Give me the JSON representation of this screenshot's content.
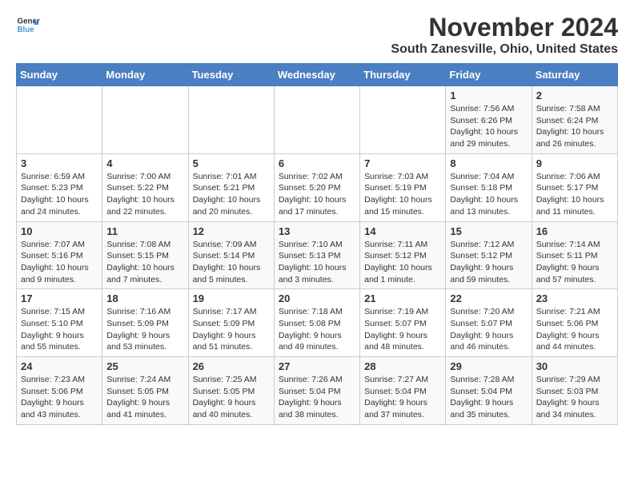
{
  "header": {
    "logo_general": "General",
    "logo_blue": "Blue",
    "month": "November 2024",
    "location": "South Zanesville, Ohio, United States"
  },
  "days_of_week": [
    "Sunday",
    "Monday",
    "Tuesday",
    "Wednesday",
    "Thursday",
    "Friday",
    "Saturday"
  ],
  "weeks": [
    [
      {
        "day": "",
        "detail": ""
      },
      {
        "day": "",
        "detail": ""
      },
      {
        "day": "",
        "detail": ""
      },
      {
        "day": "",
        "detail": ""
      },
      {
        "day": "",
        "detail": ""
      },
      {
        "day": "1",
        "detail": "Sunrise: 7:56 AM\nSunset: 6:26 PM\nDaylight: 10 hours and 29 minutes."
      },
      {
        "day": "2",
        "detail": "Sunrise: 7:58 AM\nSunset: 6:24 PM\nDaylight: 10 hours and 26 minutes."
      }
    ],
    [
      {
        "day": "3",
        "detail": "Sunrise: 6:59 AM\nSunset: 5:23 PM\nDaylight: 10 hours and 24 minutes."
      },
      {
        "day": "4",
        "detail": "Sunrise: 7:00 AM\nSunset: 5:22 PM\nDaylight: 10 hours and 22 minutes."
      },
      {
        "day": "5",
        "detail": "Sunrise: 7:01 AM\nSunset: 5:21 PM\nDaylight: 10 hours and 20 minutes."
      },
      {
        "day": "6",
        "detail": "Sunrise: 7:02 AM\nSunset: 5:20 PM\nDaylight: 10 hours and 17 minutes."
      },
      {
        "day": "7",
        "detail": "Sunrise: 7:03 AM\nSunset: 5:19 PM\nDaylight: 10 hours and 15 minutes."
      },
      {
        "day": "8",
        "detail": "Sunrise: 7:04 AM\nSunset: 5:18 PM\nDaylight: 10 hours and 13 minutes."
      },
      {
        "day": "9",
        "detail": "Sunrise: 7:06 AM\nSunset: 5:17 PM\nDaylight: 10 hours and 11 minutes."
      }
    ],
    [
      {
        "day": "10",
        "detail": "Sunrise: 7:07 AM\nSunset: 5:16 PM\nDaylight: 10 hours and 9 minutes."
      },
      {
        "day": "11",
        "detail": "Sunrise: 7:08 AM\nSunset: 5:15 PM\nDaylight: 10 hours and 7 minutes."
      },
      {
        "day": "12",
        "detail": "Sunrise: 7:09 AM\nSunset: 5:14 PM\nDaylight: 10 hours and 5 minutes."
      },
      {
        "day": "13",
        "detail": "Sunrise: 7:10 AM\nSunset: 5:13 PM\nDaylight: 10 hours and 3 minutes."
      },
      {
        "day": "14",
        "detail": "Sunrise: 7:11 AM\nSunset: 5:12 PM\nDaylight: 10 hours and 1 minute."
      },
      {
        "day": "15",
        "detail": "Sunrise: 7:12 AM\nSunset: 5:12 PM\nDaylight: 9 hours and 59 minutes."
      },
      {
        "day": "16",
        "detail": "Sunrise: 7:14 AM\nSunset: 5:11 PM\nDaylight: 9 hours and 57 minutes."
      }
    ],
    [
      {
        "day": "17",
        "detail": "Sunrise: 7:15 AM\nSunset: 5:10 PM\nDaylight: 9 hours and 55 minutes."
      },
      {
        "day": "18",
        "detail": "Sunrise: 7:16 AM\nSunset: 5:09 PM\nDaylight: 9 hours and 53 minutes."
      },
      {
        "day": "19",
        "detail": "Sunrise: 7:17 AM\nSunset: 5:09 PM\nDaylight: 9 hours and 51 minutes."
      },
      {
        "day": "20",
        "detail": "Sunrise: 7:18 AM\nSunset: 5:08 PM\nDaylight: 9 hours and 49 minutes."
      },
      {
        "day": "21",
        "detail": "Sunrise: 7:19 AM\nSunset: 5:07 PM\nDaylight: 9 hours and 48 minutes."
      },
      {
        "day": "22",
        "detail": "Sunrise: 7:20 AM\nSunset: 5:07 PM\nDaylight: 9 hours and 46 minutes."
      },
      {
        "day": "23",
        "detail": "Sunrise: 7:21 AM\nSunset: 5:06 PM\nDaylight: 9 hours and 44 minutes."
      }
    ],
    [
      {
        "day": "24",
        "detail": "Sunrise: 7:23 AM\nSunset: 5:06 PM\nDaylight: 9 hours and 43 minutes."
      },
      {
        "day": "25",
        "detail": "Sunrise: 7:24 AM\nSunset: 5:05 PM\nDaylight: 9 hours and 41 minutes."
      },
      {
        "day": "26",
        "detail": "Sunrise: 7:25 AM\nSunset: 5:05 PM\nDaylight: 9 hours and 40 minutes."
      },
      {
        "day": "27",
        "detail": "Sunrise: 7:26 AM\nSunset: 5:04 PM\nDaylight: 9 hours and 38 minutes."
      },
      {
        "day": "28",
        "detail": "Sunrise: 7:27 AM\nSunset: 5:04 PM\nDaylight: 9 hours and 37 minutes."
      },
      {
        "day": "29",
        "detail": "Sunrise: 7:28 AM\nSunset: 5:04 PM\nDaylight: 9 hours and 35 minutes."
      },
      {
        "day": "30",
        "detail": "Sunrise: 7:29 AM\nSunset: 5:03 PM\nDaylight: 9 hours and 34 minutes."
      }
    ]
  ]
}
